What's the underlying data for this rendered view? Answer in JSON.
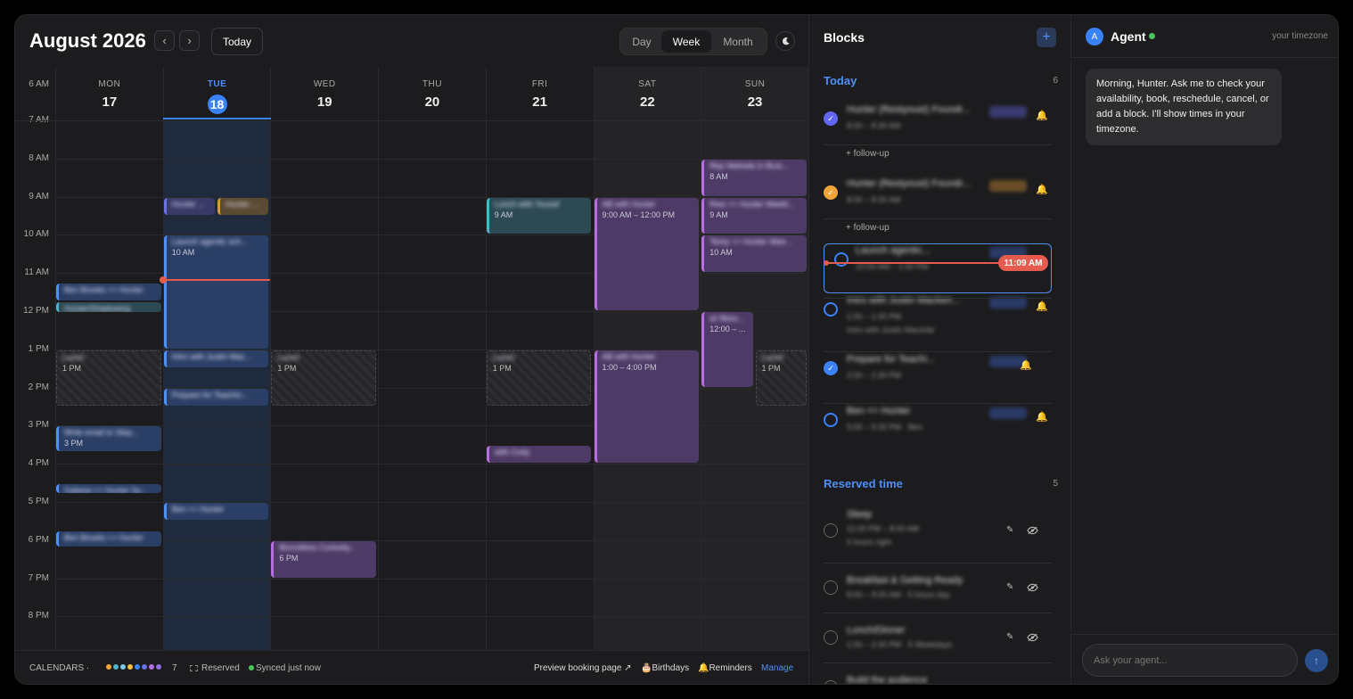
{
  "header": {
    "month_title": "August 2026",
    "prev": "‹",
    "next": "›",
    "today": "Today",
    "views": [
      "Day",
      "Week",
      "Month"
    ],
    "active_view": "Week"
  },
  "days": [
    {
      "dow": "MON",
      "num": "17"
    },
    {
      "dow": "TUE",
      "num": "18",
      "today": true
    },
    {
      "dow": "WED",
      "num": "19"
    },
    {
      "dow": "THU",
      "num": "20"
    },
    {
      "dow": "FRI",
      "num": "21"
    },
    {
      "dow": "SAT",
      "num": "22"
    },
    {
      "dow": "SUN",
      "num": "23"
    }
  ],
  "hours": [
    "6 AM",
    "7 AM",
    "8 AM",
    "9 AM",
    "10 AM",
    "11 AM",
    "12 PM",
    "1 PM",
    "2 PM",
    "3 PM",
    "4 PM",
    "5 PM",
    "6 PM",
    "7 PM",
    "8 PM"
  ],
  "events": [
    {
      "day": 0,
      "start": 11.25,
      "end": 11.75,
      "color": "blue",
      "title": "Ben Brooks <> Hunter",
      "time": ""
    },
    {
      "day": 0,
      "start": 11.75,
      "end": 12.05,
      "color": "teal",
      "title": "Hunter/Shadowing",
      "time": ""
    },
    {
      "day": 0,
      "start": 13,
      "end": 14.5,
      "color": "reserved",
      "title": "Lunch",
      "time": "1 PM"
    },
    {
      "day": 0,
      "start": 15,
      "end": 15.7,
      "color": "blue",
      "title": "Write email to Step...",
      "time": "3 PM"
    },
    {
      "day": 0,
      "start": 16.5,
      "end": 16.8,
      "color": "blue",
      "title": "Galaxia <> Hunter Sy...",
      "time": ""
    },
    {
      "day": 0,
      "start": 17.75,
      "end": 18.2,
      "color": "blue",
      "title": "Ben Brooks <> Hunter",
      "time": ""
    },
    {
      "day": 1,
      "start": 9,
      "end": 9.5,
      "color": "indigo",
      "title": "Hunter ...",
      "time": "",
      "half": "left"
    },
    {
      "day": 1,
      "start": 9,
      "end": 9.5,
      "color": "amber",
      "title": "Hunter ...",
      "time": "",
      "half": "right"
    },
    {
      "day": 1,
      "start": 10,
      "end": 13,
      "color": "blue",
      "title": "Launch agentic sch...",
      "time": "10 AM"
    },
    {
      "day": 1,
      "start": 13,
      "end": 13.5,
      "color": "blue",
      "title": "Intro with Justin Mac...",
      "time": ""
    },
    {
      "day": 1,
      "start": 14,
      "end": 14.5,
      "color": "blue",
      "title": "Prepare for Teachin...",
      "time": ""
    },
    {
      "day": 1,
      "start": 17,
      "end": 17.5,
      "color": "blue",
      "title": "Ben <> Hunter",
      "time": ""
    },
    {
      "day": 2,
      "start": 13,
      "end": 14.5,
      "color": "reserved",
      "title": "Lunch",
      "time": "1 PM"
    },
    {
      "day": 2,
      "start": 18,
      "end": 19,
      "color": "purple",
      "title": "Boundless Curiosity...",
      "time": "6 PM"
    },
    {
      "day": 4,
      "start": 9,
      "end": 10,
      "color": "teal",
      "title": "Lunch with Yousef",
      "time": "9 AM"
    },
    {
      "day": 4,
      "start": 13,
      "end": 14.5,
      "color": "reserved",
      "title": "Lunch",
      "time": "1 PM"
    },
    {
      "day": 4,
      "start": 15.5,
      "end": 16,
      "color": "purple",
      "title": "with Cody",
      "time": ""
    },
    {
      "day": 5,
      "start": 9,
      "end": 12,
      "color": "purple",
      "title": "AB with Hunter",
      "time": "9:00 AM – 12:00 PM"
    },
    {
      "day": 5,
      "start": 13,
      "end": 16,
      "color": "purple",
      "title": "AB with Hunter",
      "time": "1:00 – 4:00 PM"
    },
    {
      "day": 6,
      "start": 8,
      "end": 9,
      "color": "purple",
      "title": "Rep Website in Busi...",
      "time": "8 AM"
    },
    {
      "day": 6,
      "start": 9,
      "end": 10,
      "color": "purple",
      "title": "Rwo <> Hunter Weekl...",
      "time": "9 AM"
    },
    {
      "day": 6,
      "start": 10,
      "end": 11,
      "color": "purple",
      "title": "Terey <> Hunter Wee...",
      "time": "10 AM"
    },
    {
      "day": 6,
      "start": 12,
      "end": 14,
      "color": "purple",
      "title": "w/ Bess...",
      "time": "12:00 – ...",
      "half": "left"
    },
    {
      "day": 6,
      "start": 13,
      "end": 14.5,
      "color": "reserved",
      "title": "Lunch",
      "time": "1 PM",
      "half": "right"
    }
  ],
  "now_hour": 11.17,
  "footer": {
    "calendars_label": "CALENDARS ·",
    "calendar_count": "7",
    "calendar_colors": [
      "#f0a33b",
      "#4fb3c9",
      "#7cc7e8",
      "#f0c040",
      "#3b82f6",
      "#6b6fe8",
      "#b76ee0",
      "#8e6ee0"
    ],
    "reserved": "Reserved",
    "synced": "Synced just now",
    "preview": "Preview booking page ↗",
    "birthdays": "🎂Birthdays",
    "reminders": "🔔Reminders",
    "manage": "Manage"
  },
  "blocks": {
    "title": "Blocks",
    "add": "+",
    "today_label": "Today",
    "today_count": "6",
    "followup": "+ follow-up",
    "now_time": "11:09 AM",
    "today_items": [
      {
        "title": "Hunter (Restyoust) Foundr...",
        "sub": "8:00 – 8:30 AM",
        "state": "checked-indigo"
      },
      {
        "title": "Hunter (Restyoust) Foundr...",
        "sub": "8:00 – 8:30 AM",
        "state": "checked-amber"
      },
      {
        "title": "Launch agentic...",
        "sub": "10:00 AM – 1:00 PM",
        "state": "open"
      },
      {
        "title": "Intro with Justin Macken...",
        "sub": "1:00 – 1:30 PM",
        "sub2": "Intro with Justin Macinlai",
        "state": "open"
      },
      {
        "title": "Prepare for Teachi...",
        "sub": "2:00 – 2:30 PM",
        "state": "checked"
      },
      {
        "title": "Ben <> Hunter",
        "sub": "5:00 – 5:30 PM · Ben",
        "state": "open"
      }
    ],
    "reserved_label": "Reserved time",
    "reserved_count": "5",
    "reserved_items": [
      {
        "title": "Sleep",
        "sub": "11:00 PM – 8:00 AM",
        "sub2": "5 hours right"
      },
      {
        "title": "Breakfast & Getting Ready",
        "sub": "8:00 – 9:00 AM · 5 hours day"
      },
      {
        "title": "Lunch/Dinner",
        "sub": "1:00 – 2:30 PM · 5 Weekdays"
      },
      {
        "title": "Build the audience",
        "sub": ""
      }
    ]
  },
  "agent": {
    "avatar": "A",
    "name": "Agent",
    "timezone": "your timezone",
    "message": "Morning, Hunter. Ask me to check your availability, book, reschedule, cancel, or add a block. I'll show times in your timezone.",
    "placeholder": "Ask your agent...",
    "send": "↑"
  }
}
